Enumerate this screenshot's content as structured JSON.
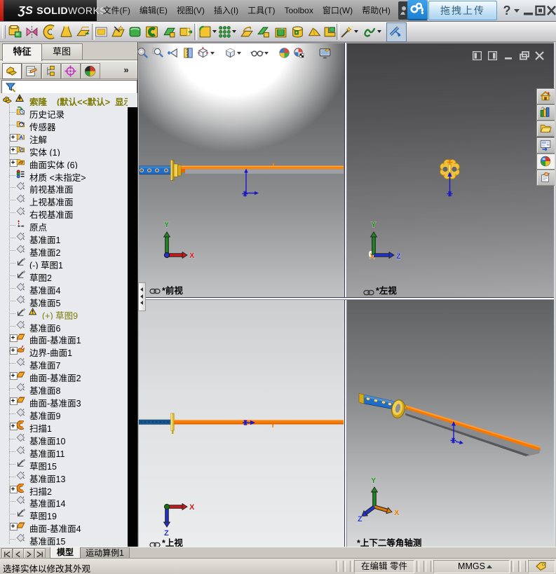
{
  "app": {
    "logo_3ds": "ƷS",
    "logo_solid": "SOLID",
    "logo_works": "WORKS"
  },
  "titlebar": {
    "menus": [
      "文件(F)",
      "编辑(E)",
      "视图(V)",
      "插入(I)",
      "工具(T)",
      "Toolbox",
      "窗口(W)",
      "帮助(H)"
    ],
    "upload_label": "拖拽上传",
    "help_label": "?"
  },
  "toolbar": {
    "items": [
      {
        "icon": "tb-insert"
      },
      {
        "icon": "tb-revolve"
      },
      {
        "icon": "tb-sweep"
      },
      {
        "icon": "tb-loft"
      },
      {
        "icon": "tb-flatten"
      },
      {
        "sep": true
      },
      {
        "icon": "tb-planar"
      },
      {
        "icon": "tb-fill"
      },
      {
        "icon": "tb-knit"
      },
      {
        "icon": "tb-trim"
      },
      {
        "icon": "tb-untrim"
      },
      {
        "icon": "tb-extend"
      },
      {
        "sep": true
      },
      {
        "icon": "tb-fillet",
        "dd": true
      },
      {
        "icon": "tb-pattern",
        "dd": true
      },
      {
        "icon": "tb-offset"
      },
      {
        "icon": "tb-ruled"
      },
      {
        "icon": "tb-replace"
      },
      {
        "icon": "tb-cylinder"
      },
      {
        "icon": "tb-pyramid"
      },
      {
        "icon": "tb-corner"
      },
      {
        "sep": true
      },
      {
        "icon": "tb-wand",
        "dd": true
      },
      {
        "icon": "tb-spline",
        "dd": true
      },
      {
        "icon": "tb-measure",
        "pressed": true
      }
    ]
  },
  "left_panel": {
    "tabs": [
      {
        "label": "特征",
        "active": true
      },
      {
        "label": "草图",
        "active": false
      }
    ],
    "managers": [
      "mg-feature",
      "mg-props",
      "mg-config",
      "mg-dimx",
      "mg-display"
    ],
    "more_label": "»",
    "root": {
      "name": "索隆",
      "suffix": "(默认<<默认>_显示状态",
      "icon": "tr-part",
      "warn_icon": "tr-errtri"
    },
    "tree": [
      {
        "label": "历史记录",
        "icon": "tr-history"
      },
      {
        "label": "传感器",
        "icon": "tr-sensor"
      },
      {
        "label": "注解",
        "icon": "tr-ann",
        "expand": true
      },
      {
        "label": "实体 (1)",
        "icon": "tr-solids",
        "expand": true
      },
      {
        "label": "曲面实体 (6)",
        "icon": "tr-surfbodies",
        "expand": true
      },
      {
        "label": "材质 <未指定>",
        "icon": "tr-material"
      },
      {
        "label": "前视基准面",
        "icon": "tr-plane"
      },
      {
        "label": "上视基准面",
        "icon": "tr-plane"
      },
      {
        "label": "右视基准面",
        "icon": "tr-plane"
      },
      {
        "label": "原点",
        "icon": "tr-origin"
      },
      {
        "label": "基准面1",
        "icon": "tr-plane"
      },
      {
        "label": "基准面2",
        "icon": "tr-plane"
      },
      {
        "label": "(-) 草图1",
        "icon": "tr-sketch"
      },
      {
        "label": "草图2",
        "icon": "tr-sketch"
      },
      {
        "label": "基准面4",
        "icon": "tr-plane"
      },
      {
        "label": "基准面5",
        "icon": "tr-plane"
      },
      {
        "label": "(+) 草图9",
        "icon": "tr-sketch",
        "warn": true
      },
      {
        "label": "基准面6",
        "icon": "tr-plane"
      },
      {
        "label": "曲面-基准面1",
        "icon": "tr-surfplane",
        "expand": true
      },
      {
        "label": "边界-曲面1",
        "icon": "tr-boundary",
        "expand": true
      },
      {
        "label": "基准面7",
        "icon": "tr-plane"
      },
      {
        "label": "曲面-基准面2",
        "icon": "tr-surfplane",
        "expand": true
      },
      {
        "label": "基准面8",
        "icon": "tr-plane"
      },
      {
        "label": "曲面-基准面3",
        "icon": "tr-surfplane",
        "expand": true
      },
      {
        "label": "基准面9",
        "icon": "tr-plane"
      },
      {
        "label": "扫描1",
        "icon": "tr-sweep",
        "expand": true
      },
      {
        "label": "基准面10",
        "icon": "tr-plane"
      },
      {
        "label": "基准面11",
        "icon": "tr-plane"
      },
      {
        "label": "草图15",
        "icon": "tr-sketch"
      },
      {
        "label": "基准面13",
        "icon": "tr-plane"
      },
      {
        "label": "扫描2",
        "icon": "tr-sweep",
        "expand": true
      },
      {
        "label": "基准面14",
        "icon": "tr-plane"
      },
      {
        "label": "草图19",
        "icon": "tr-sketch"
      },
      {
        "label": "曲面-基准面4",
        "icon": "tr-surfplane",
        "expand": true
      },
      {
        "label": "基准面15",
        "icon": "tr-plane"
      }
    ]
  },
  "viewports": {
    "headsup": [
      {
        "icon": "hu-zoomfit"
      },
      {
        "icon": "hu-zoomarea"
      },
      {
        "icon": "hu-prev"
      },
      {
        "icon": "hu-section"
      },
      {
        "icon": "hu-vieworient",
        "dd": true
      },
      {
        "icon": "hu-dispstyle",
        "dd": true
      },
      {
        "icon": "hu-glasses",
        "dd": true
      },
      {
        "icon": "hu-ball"
      },
      {
        "icon": "hu-scene"
      },
      {
        "icon": "hu-monitor"
      }
    ],
    "front": {
      "label": "*前视",
      "linked": true,
      "axis_up": "Y",
      "axis_right": "X"
    },
    "left": {
      "label": "*左视",
      "linked": true,
      "axis_up": "Y",
      "axis_right": "Z"
    },
    "top": {
      "label": "*上视",
      "linked": true,
      "axis_right": "X",
      "axis_down": "Z"
    },
    "iso": {
      "label": "*上下二等角轴测",
      "linked": false,
      "axis_up": "Y",
      "axis_right": "X",
      "axis_left": "Z"
    }
  },
  "taskpane": [
    "tp-home",
    "tp-library",
    "tp-folder",
    "tp-palette",
    "tp-appearance",
    "tp-props"
  ],
  "bottom": {
    "nav": [
      "first",
      "prev",
      "next",
      "last"
    ],
    "tabs": [
      {
        "label": "模型",
        "active": true
      },
      {
        "label": "运动算例1",
        "active": false
      }
    ]
  },
  "statusbar": {
    "message": "选择实体以修改其外观",
    "mode": "在编辑 零件",
    "units": "MMGS"
  },
  "colors": {
    "accent_blue": "#1b7fd4",
    "gold": "#f2c431",
    "orange_blade": "#f57900",
    "handle_blue": "#1e6ec8",
    "olive_warn": "#7c7c05"
  }
}
